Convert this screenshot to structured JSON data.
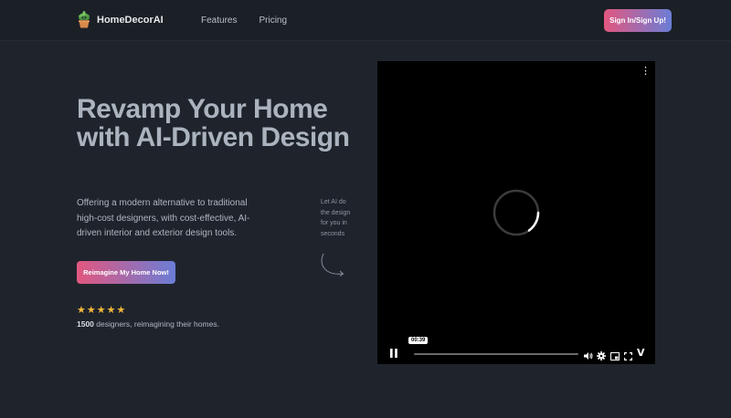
{
  "header": {
    "brand": "HomeDecorAI",
    "nav": [
      {
        "label": "Features"
      },
      {
        "label": "Pricing"
      }
    ],
    "signin_label": "Sign In/Sign Up!"
  },
  "hero": {
    "title": "Revamp Your Home with AI-Driven Design",
    "description": "Offering a modern alternative to traditional high-cost designers, with cost-effective, AI-driven interior and exterior design tools.",
    "cta_label": "Reimagine My Home Now!",
    "rating_stars": 5,
    "social_count": "1500",
    "social_text": " designers, reimagining their homes."
  },
  "side_note": "Let AI do the design for you in seconds",
  "video": {
    "time": "00:39",
    "icons": [
      "more-vertical-icon",
      "loading-spinner-icon",
      "pause-icon",
      "volume-icon",
      "gear-icon",
      "pip-icon",
      "fullscreen-icon",
      "vimeo-icon"
    ],
    "brand_mark": "V"
  },
  "colors": {
    "background": "#1f242c",
    "header": "#1b1f26",
    "gradient_start": "#e2577f",
    "gradient_end": "#6a7dd6",
    "star": "#f5b83a"
  }
}
